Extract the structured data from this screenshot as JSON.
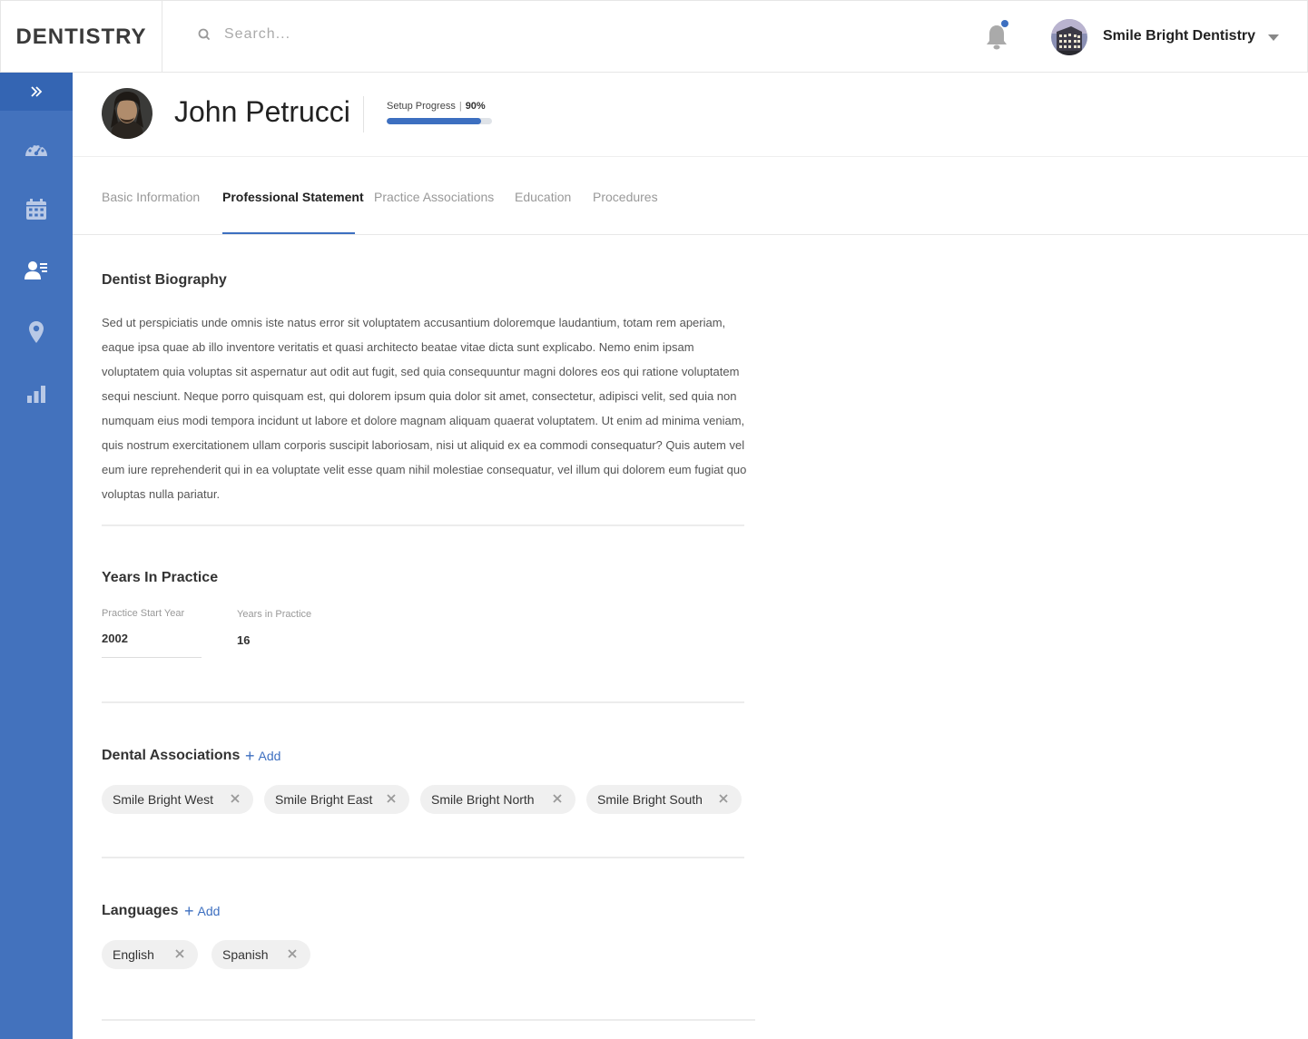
{
  "app": {
    "logo": "DENTISTRY"
  },
  "search": {
    "placeholder": "Search..."
  },
  "header": {
    "org_name": "Smile Bright Dentistry"
  },
  "sidebar": {
    "items": [
      {
        "icon": "dashboard-gauge-icon"
      },
      {
        "icon": "calendar-icon"
      },
      {
        "icon": "user-list-icon"
      },
      {
        "icon": "location-pin-icon"
      },
      {
        "icon": "bar-chart-icon"
      }
    ]
  },
  "profile": {
    "name": "John Petrucci",
    "progress_label": "Setup Progress",
    "progress_value_text": "90%",
    "progress_fraction": 0.9
  },
  "tabs": [
    {
      "label": "Basic Information"
    },
    {
      "label": "Professional Statement"
    },
    {
      "label": "Practice Associations"
    },
    {
      "label": "Education"
    },
    {
      "label": "Procedures"
    }
  ],
  "biography": {
    "title": "Dentist Biography",
    "text": "Sed ut perspiciatis unde omnis iste natus error sit voluptatem accusantium doloremque laudantium, totam rem aperiam, eaque ipsa quae ab illo inventore veritatis et quasi architecto beatae vitae dicta sunt explicabo. Nemo enim ipsam voluptatem quia voluptas sit aspernatur aut odit aut fugit, sed quia consequuntur magni dolores eos qui ratione voluptatem sequi nesciunt. Neque porro quisquam est, qui dolorem ipsum quia dolor sit amet, consectetur, adipisci velit, sed quia non numquam eius modi tempora incidunt ut labore et dolore magnam aliquam quaerat voluptatem. Ut enim ad minima veniam, quis nostrum exercitationem ullam corporis suscipit laboriosam, nisi ut aliquid ex ea commodi consequatur? Quis autem vel eum iure reprehenderit qui in ea voluptate velit esse quam nihil molestiae consequatur, vel illum qui dolorem eum fugiat quo voluptas nulla pariatur."
  },
  "years": {
    "title": "Years In Practice",
    "start_label": "Practice Start Year",
    "start_value": "2002",
    "years_label": "Years in Practice",
    "years_value": "16"
  },
  "associations": {
    "title": "Dental Associations",
    "add_label": "Add",
    "chips": [
      "Smile Bright West",
      "Smile Bright East",
      "Smile Bright North",
      "Smile Bright South"
    ]
  },
  "languages": {
    "title": "Languages",
    "add_label": "Add",
    "chips": [
      "English",
      "Spanish"
    ]
  },
  "colors": {
    "accent": "#3d6fc0",
    "sidebar": "#4372bd",
    "sidebar_toggle": "#3465b3"
  }
}
